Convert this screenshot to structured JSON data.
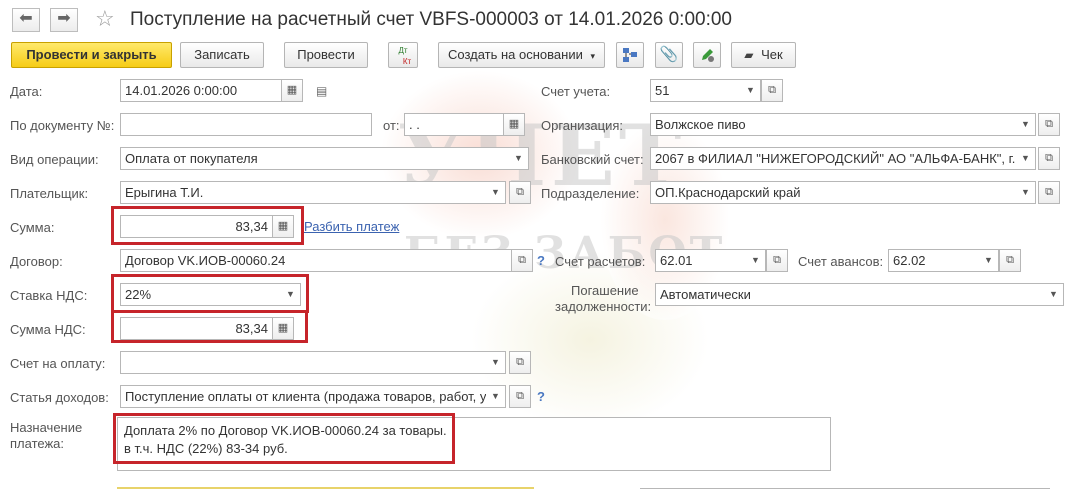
{
  "window": {
    "title": "Поступление на расчетный счет VBFS-000003 от 14.01.2026 0:00:00",
    "nav_back": "⬅",
    "nav_forward": "➡",
    "favorite_icon": "star-icon"
  },
  "toolbar": {
    "post_close": "Провести и закрыть",
    "save": "Записать",
    "post": "Провести",
    "dtkt_dt": "Дт",
    "dtkt_kt": "Кт",
    "create_based": "Создать на основании",
    "check": "Чек"
  },
  "watermark": {
    "line1": "УЧЕТ",
    "line2": "БЕЗ ЗАБОТ"
  },
  "form": {
    "date": {
      "label": "Дата:",
      "value": "14.01.2026  0:00:00"
    },
    "doc_no": {
      "label": "По документу №:",
      "value": "",
      "from_label": "от:",
      "from_value": "  .  .    "
    },
    "op_type": {
      "label": "Вид операции:",
      "value": "Оплата от покупателя"
    },
    "payer": {
      "label": "Плательщик:",
      "value": "Ерыгина Т.И."
    },
    "amount": {
      "label": "Сумма:",
      "value": "83,34",
      "split_link": "Разбить платеж"
    },
    "contract": {
      "label": "Договор:",
      "value": "Договор VK.ИОВ-00060.24"
    },
    "vat_rate": {
      "label": "Ставка НДС:",
      "value": "22%"
    },
    "vat_amount": {
      "label": "Сумма НДС:",
      "value": "83,34"
    },
    "invoice": {
      "label": "Счет на оплату:",
      "value": ""
    },
    "income_item": {
      "label": "Статья доходов:",
      "value": "Поступление оплаты от клиента (продажа товаров, работ, ус"
    },
    "purpose": {
      "label_line1": "Назначение",
      "label_line2": "платежа:",
      "line1": "Доплата 2% по Договор VK.ИОВ-00060.24 за товары.",
      "line2": "в т.ч. НДС (22%) 83-34 руб."
    },
    "account": {
      "label": "Счет учета:",
      "value": "51"
    },
    "org": {
      "label": "Организация:",
      "value": "Волжское пиво"
    },
    "bank_account": {
      "label": "Банковский счет:",
      "value": "2067 в ФИЛИАЛ \"НИЖЕГОРОДСКИЙ\" АО \"АЛЬФА-БАНК\", г."
    },
    "division": {
      "label": "Подразделение:",
      "value": "ОП.Краснодарский край"
    },
    "settle_account": {
      "label": "Счет расчетов:",
      "value": "62.01"
    },
    "advance_account": {
      "label": "Счет авансов:",
      "value": "62.02"
    },
    "debt_repay": {
      "label_line1": "Погашение",
      "label_line2": "задолженности:",
      "value": "Автоматически"
    },
    "help_mark": "?"
  },
  "colors": {
    "primary_button": "#f6cc16",
    "highlight_frame": "#c6242a",
    "link": "#3b63b0"
  }
}
